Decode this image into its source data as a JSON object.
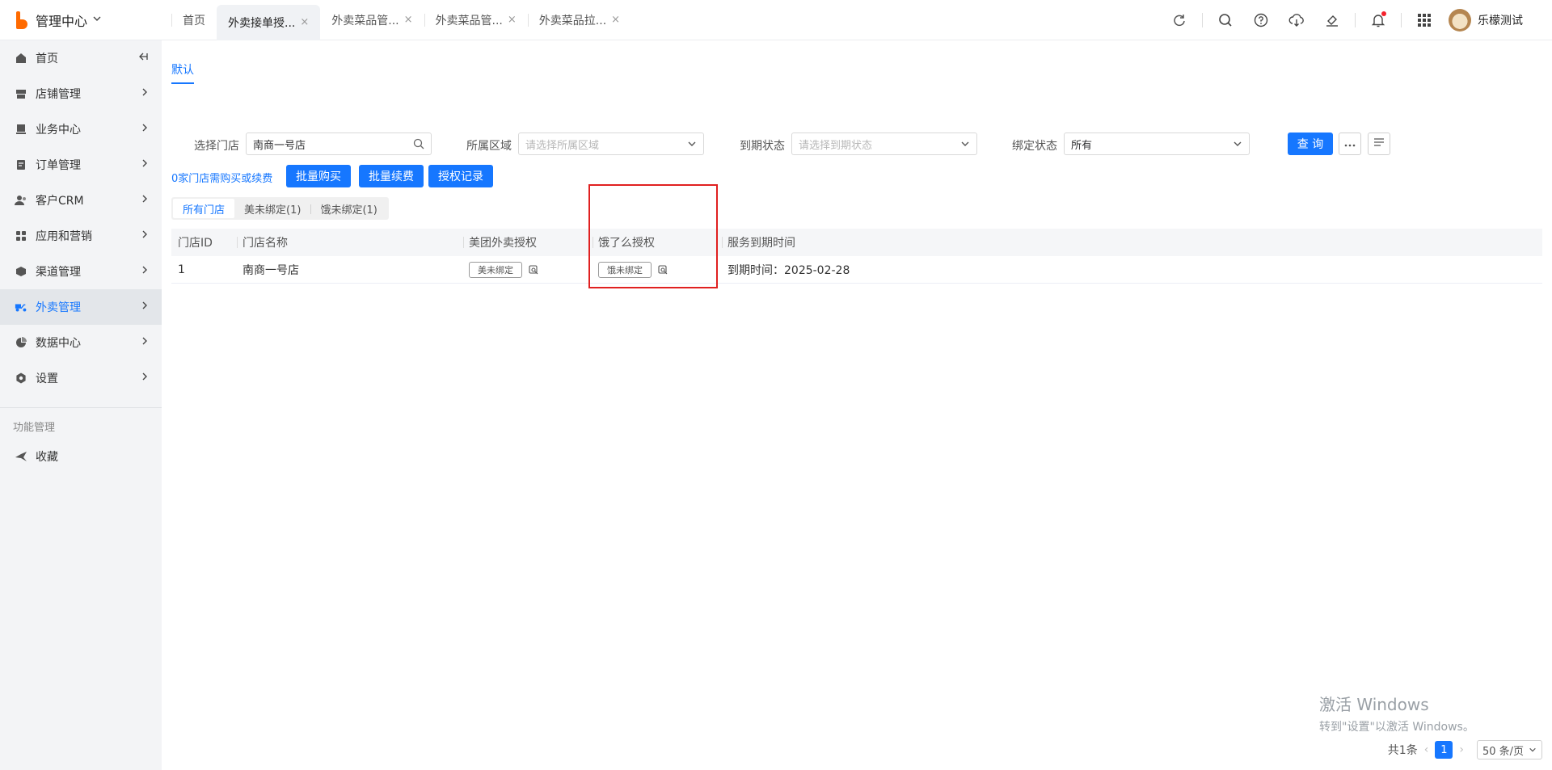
{
  "brand": {
    "title": "管理中心"
  },
  "tabs": [
    {
      "label": "首页"
    },
    {
      "label": "外卖接单授..."
    },
    {
      "label": "外卖菜品管..."
    },
    {
      "label": "外卖菜品管..."
    },
    {
      "label": "外卖菜品拉..."
    }
  ],
  "user": {
    "name": "乐檬测试"
  },
  "topbar_icons": [
    "refresh-icon",
    "search-icon",
    "help-icon",
    "cloud-download-icon",
    "clear-icon",
    "bell-icon",
    "apps-grid-icon"
  ],
  "sidebar": {
    "items": [
      {
        "label": "首页",
        "icon": "home-icon"
      },
      {
        "label": "店铺管理",
        "icon": "store-icon"
      },
      {
        "label": "业务中心",
        "icon": "business-icon"
      },
      {
        "label": "订单管理",
        "icon": "order-icon"
      },
      {
        "label": "客户CRM",
        "icon": "customer-icon"
      },
      {
        "label": "应用和营销",
        "icon": "apps-icon"
      },
      {
        "label": "渠道管理",
        "icon": "channel-icon"
      },
      {
        "label": "外卖管理",
        "icon": "delivery-icon"
      },
      {
        "label": "数据中心",
        "icon": "data-icon"
      },
      {
        "label": "设置",
        "icon": "settings-icon"
      }
    ],
    "group_label": "功能管理",
    "favorites_label": "收藏"
  },
  "sub_tab": "默认",
  "filters": {
    "store": {
      "label": "选择门店",
      "value": "南商一号店"
    },
    "region": {
      "label": "所属区域",
      "placeholder": "请选择所属区域"
    },
    "expire": {
      "label": "到期状态",
      "placeholder": "请选择到期状态"
    },
    "bind": {
      "label": "绑定状态",
      "value": "所有"
    },
    "query_label": "查 询"
  },
  "actions": {
    "notice": "0家门店需购买或续费",
    "batch_buy": "批量购买",
    "batch_renew": "批量续费",
    "auth_record": "授权记录"
  },
  "segments": [
    "所有门店",
    "美未绑定(1)",
    "饿未绑定(1)"
  ],
  "table": {
    "columns": [
      "门店ID",
      "门店名称",
      "美团外卖授权",
      "饿了么授权",
      "服务到期时间"
    ],
    "rows": [
      {
        "id": "1",
        "name": "南商一号店",
        "meituan": "美未绑定",
        "eleme": "饿未绑定",
        "expire": "到期时间：2025-02-28"
      }
    ]
  },
  "activation": {
    "title": "激活 Windows",
    "sub": "转到\"设置\"以激活 Windows。"
  },
  "pagination": {
    "total": "共1条",
    "page": "1",
    "page_size": "50 条/页"
  },
  "colors": {
    "primary": "#1677ff",
    "brand": "#ff6a00",
    "highlight": "#e02020"
  }
}
